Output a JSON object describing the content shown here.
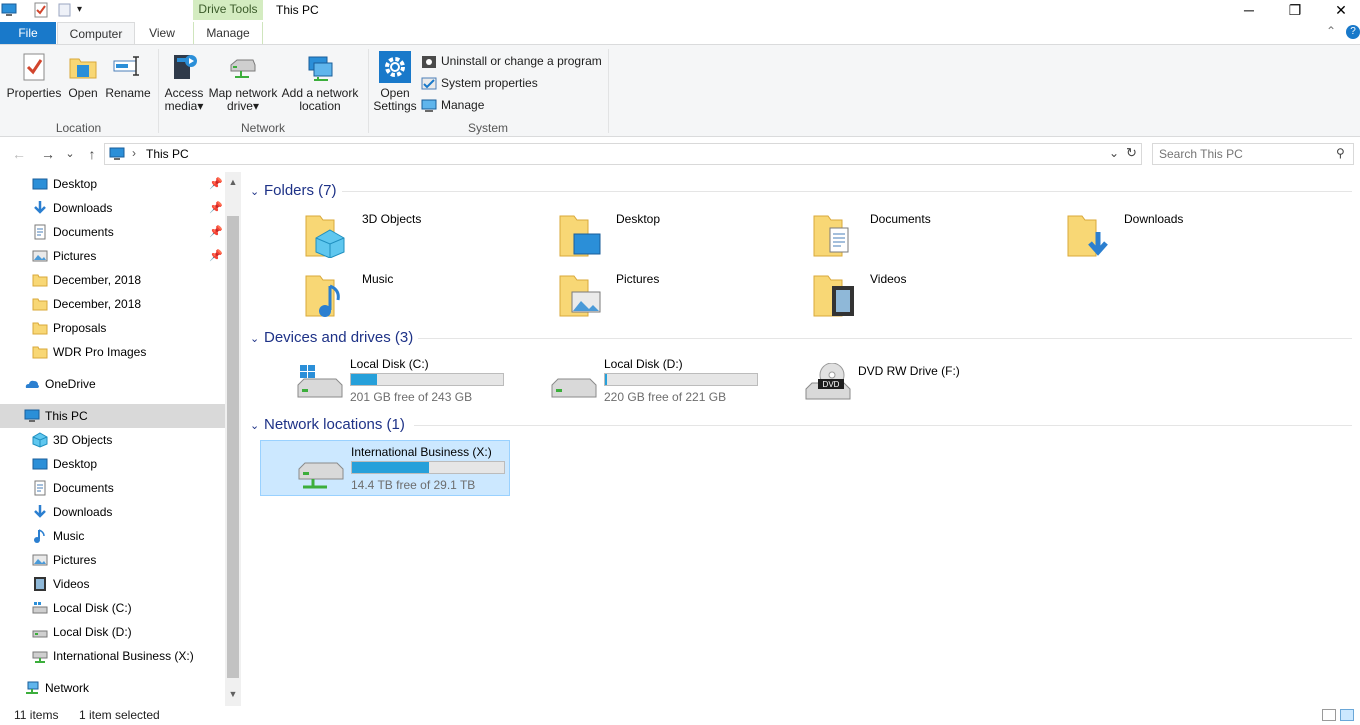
{
  "window": {
    "title": "This PC",
    "contextual_tab": "Drive Tools",
    "controls": {
      "minimize": "─",
      "maximize": "❐",
      "close": "✕"
    },
    "help": "?",
    "collapse": "⌃"
  },
  "tabs": {
    "file": "File",
    "computer": "Computer",
    "view": "View",
    "manage": "Manage"
  },
  "ribbon": {
    "location": {
      "label": "Location",
      "properties": "Properties",
      "open": "Open",
      "rename": "Rename"
    },
    "network": {
      "label": "Network",
      "access_media": "Access media",
      "map_network_drive": "Map network drive",
      "add_network_location": "Add a network location",
      "dropdown_glyph": "▾"
    },
    "system": {
      "label": "System",
      "open_settings": "Open Settings",
      "uninstall": "Uninstall or change a program",
      "system_properties": "System properties",
      "manage": "Manage"
    }
  },
  "address": {
    "back": "←",
    "forward": "→",
    "recent": "⌄",
    "up": "↑",
    "separator": "›",
    "path": "This PC",
    "dropdown": "⌄",
    "refresh": "↻",
    "search_placeholder": "Search This PC",
    "search_glyph": "⚲"
  },
  "sidebar": {
    "pin_glyph": "📌",
    "scroll_up": "▲",
    "scroll_down": "▼",
    "quick_access": [
      {
        "label": "Desktop",
        "icon": "desktop-icon",
        "pinned": true
      },
      {
        "label": "Downloads",
        "icon": "downloads-icon",
        "pinned": true
      },
      {
        "label": "Documents",
        "icon": "documents-icon",
        "pinned": true
      },
      {
        "label": "Pictures",
        "icon": "pictures-icon",
        "pinned": true
      },
      {
        "label": "December, 2018",
        "icon": "folder-icon",
        "pinned": false
      },
      {
        "label": "December, 2018",
        "icon": "folder-icon",
        "pinned": false
      },
      {
        "label": "Proposals",
        "icon": "folder-icon",
        "pinned": false
      },
      {
        "label": "WDR Pro Images",
        "icon": "folder-icon",
        "pinned": false
      }
    ],
    "onedrive": "OneDrive",
    "this_pc": "This PC",
    "this_pc_children": [
      {
        "label": "3D Objects",
        "icon": "3d-objects-icon"
      },
      {
        "label": "Desktop",
        "icon": "desktop-icon"
      },
      {
        "label": "Documents",
        "icon": "documents-icon"
      },
      {
        "label": "Downloads",
        "icon": "downloads-icon"
      },
      {
        "label": "Music",
        "icon": "music-icon"
      },
      {
        "label": "Pictures",
        "icon": "pictures-icon"
      },
      {
        "label": "Videos",
        "icon": "videos-icon"
      },
      {
        "label": "Local Disk (C:)",
        "icon": "local-disk-c-icon"
      },
      {
        "label": "Local Disk (D:)",
        "icon": "local-disk-d-icon"
      },
      {
        "label": "International Business (X:)",
        "icon": "network-drive-icon"
      }
    ],
    "network": "Network"
  },
  "main": {
    "folders_header": "Folders (7)",
    "folders": [
      {
        "name": "3D Objects",
        "icon": "3d-objects-icon"
      },
      {
        "name": "Desktop",
        "icon": "desktop-icon"
      },
      {
        "name": "Documents",
        "icon": "documents-icon"
      },
      {
        "name": "Downloads",
        "icon": "downloads-icon"
      },
      {
        "name": "Music",
        "icon": "music-icon"
      },
      {
        "name": "Pictures",
        "icon": "pictures-icon"
      },
      {
        "name": "Videos",
        "icon": "videos-icon"
      }
    ],
    "devices_header": "Devices and drives (3)",
    "drives": [
      {
        "name": "Local Disk (C:)",
        "free": "201 GB free of 243 GB",
        "used_fraction": 0.173,
        "icon": "windows-drive-icon"
      },
      {
        "name": "Local Disk (D:)",
        "free": "220 GB free of 221 GB",
        "used_fraction": 0.005,
        "icon": "hard-drive-icon"
      },
      {
        "name": "DVD RW Drive (F:)",
        "icon": "dvd-drive-icon",
        "badge": "DVD"
      }
    ],
    "network_header": "Network locations (1)",
    "network_drives": [
      {
        "name": "International Business (X:)",
        "free": "14.4 TB free of 29.1 TB",
        "used_fraction": 0.505,
        "icon": "network-drive-icon"
      }
    ]
  },
  "status": {
    "item_count": "11 items",
    "selection": "1 item selected"
  },
  "colors": {
    "accent": "#1979ca",
    "selection": "#cce8ff",
    "progress": "#26a0da",
    "group_header": "#1e3287",
    "drive_tools": "#d4ecc1"
  }
}
